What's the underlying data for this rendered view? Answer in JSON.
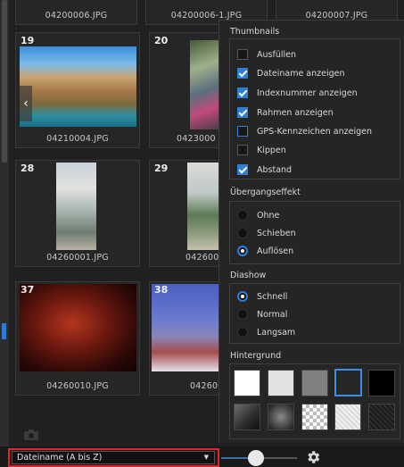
{
  "thumbnails": [
    {
      "num": "",
      "caption": "04200006.JPG"
    },
    {
      "num": "",
      "caption": "04200006-1.JPG"
    },
    {
      "num": "",
      "caption": "04200007.JPG"
    },
    {
      "num": "19",
      "caption": "04210004.JPG"
    },
    {
      "num": "20",
      "caption": "0423000"
    },
    {
      "num": "28",
      "caption": "04260001.JPG"
    },
    {
      "num": "29",
      "caption": "042600"
    },
    {
      "num": "37",
      "caption": "04260010.JPG"
    },
    {
      "num": "38",
      "caption": "0426001"
    }
  ],
  "panel": {
    "thumbnails_title": "Thumbnails",
    "options": [
      {
        "label": "Ausfüllen",
        "checked": false
      },
      {
        "label": "Dateiname anzeigen",
        "checked": true
      },
      {
        "label": "Indexnummer anzeigen",
        "checked": true
      },
      {
        "label": "Rahmen anzeigen",
        "checked": true
      },
      {
        "label": "GPS-Kennzeichen anzeigen",
        "checked": false
      },
      {
        "label": "Kippen",
        "checked": false
      },
      {
        "label": "Abstand",
        "checked": true
      }
    ],
    "transition_title": "Übergangseffekt",
    "transition_options": [
      {
        "label": "Ohne",
        "selected": false
      },
      {
        "label": "Schieben",
        "selected": false
      },
      {
        "label": "Auflösen",
        "selected": true
      }
    ],
    "slideshow_title": "Diashow",
    "slideshow_options": [
      {
        "label": "Schnell",
        "selected": true
      },
      {
        "label": "Normal",
        "selected": false
      },
      {
        "label": "Langsam",
        "selected": false
      }
    ],
    "background_title": "Hintergrund",
    "selected_background_index": 3
  },
  "bottom": {
    "sort_value": "Dateiname (A bis Z)",
    "zoom_level": 0.45
  },
  "colors": {
    "accent": "#2f7fd4",
    "highlight_frame": "#e0242a"
  }
}
